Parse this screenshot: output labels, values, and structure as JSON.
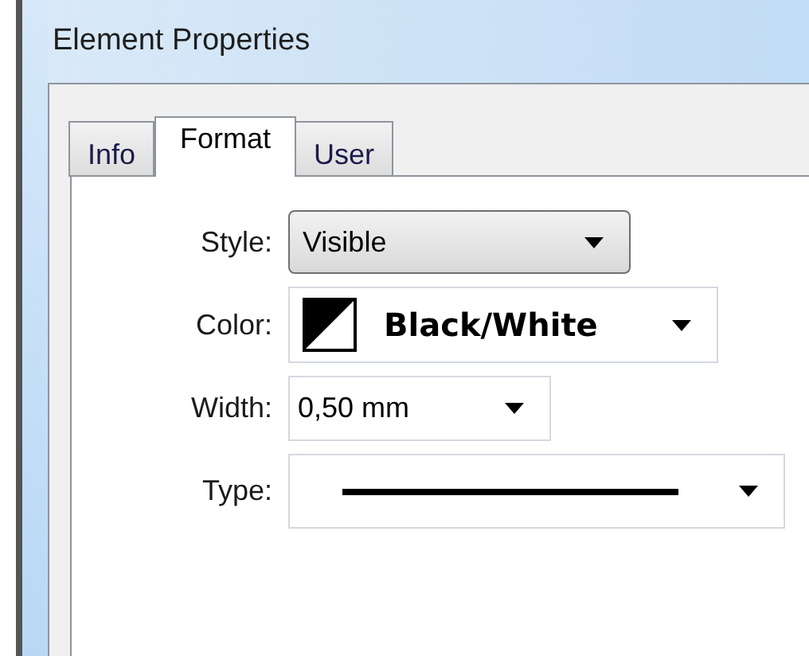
{
  "window": {
    "title": "Element Properties"
  },
  "tabs": [
    {
      "label": "Info",
      "selected": false
    },
    {
      "label": "Format",
      "selected": true
    },
    {
      "label": "User",
      "selected": false
    }
  ],
  "fields": [
    {
      "kind": "button",
      "label": "Style:",
      "value": "Visible"
    },
    {
      "kind": "color",
      "label": "Color:",
      "value": "Black/White"
    },
    {
      "kind": "plain",
      "label": "Width:",
      "value": "0,50 mm"
    },
    {
      "kind": "line",
      "label": "Type:"
    }
  ]
}
